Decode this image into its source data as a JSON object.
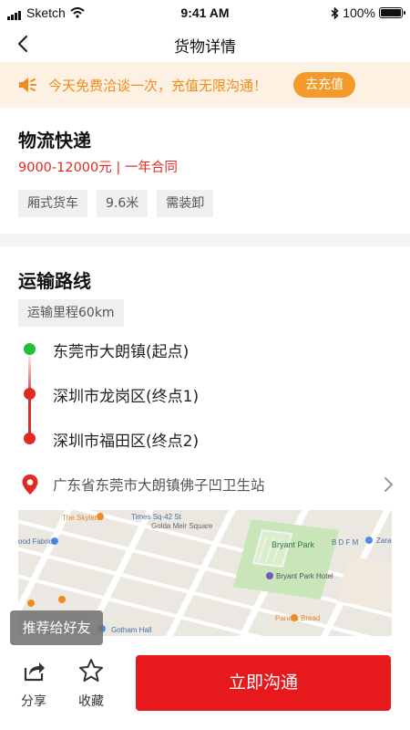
{
  "status_bar": {
    "carrier": "Sketch",
    "time": "9:41 AM",
    "battery": "100%",
    "battery_level": 1.0
  },
  "navbar": {
    "title": "货物详情"
  },
  "notice": {
    "text": "今天免费洽谈一次，充值无限沟通！",
    "button_label": "去充值"
  },
  "cargo": {
    "title": "物流快递",
    "price": "9000-12000元 | 一年合同",
    "tags": [
      "厢式货车",
      "9.6米",
      "需装卸"
    ]
  },
  "route": {
    "title": "运输路线",
    "mileage": "运输里程60km",
    "stops": [
      {
        "label": "东莞市大朗镇(起点)",
        "color": "#22c03a"
      },
      {
        "label": "深圳市龙岗区(终点1)",
        "color": "#e02a22"
      },
      {
        "label": "深圳市福田区(终点2)",
        "color": "#e02a22"
      }
    ],
    "address": "广东省东莞市大朗镇佛子凹卫生站"
  },
  "map": {
    "labels": [
      "The Skylark",
      "Times Sq-42 St",
      "Golda Meir Square",
      "Bryant Park",
      "Bryant Park Hotel",
      "Panera Bread",
      "Gotham Hall",
      "Zara",
      "B D F M",
      "ood Fabrics"
    ]
  },
  "bottom": {
    "share_tip": "推荐给好友",
    "share_label": "分享",
    "favorite_label": "收藏",
    "chat_label": "立即沟通"
  },
  "colors": {
    "accent": "#e8191c",
    "orange": "#f59a2a",
    "start": "#22c03a",
    "end": "#e02a22"
  }
}
